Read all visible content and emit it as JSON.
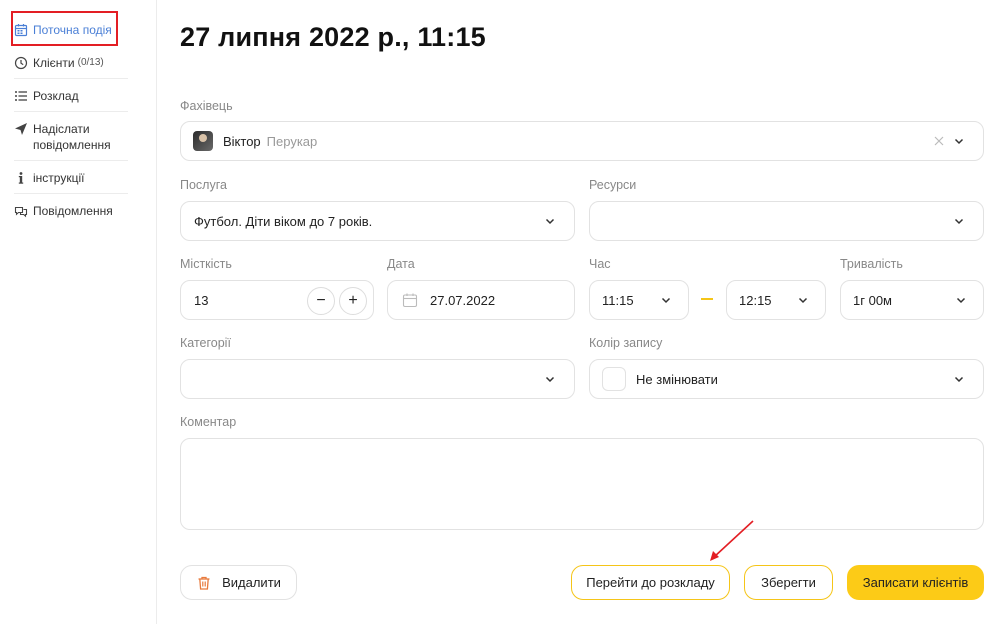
{
  "sidebar": {
    "items": [
      {
        "label": "Поточна подія",
        "icon": "calendar-icon"
      },
      {
        "label": "Клієнти",
        "count": "(0/13)",
        "icon": "clock-icon"
      },
      {
        "label": "Розклад",
        "icon": "list-icon"
      },
      {
        "label": "Надіслати повідомлення",
        "icon": "send-icon"
      },
      {
        "label": "інструкції",
        "icon": "info-icon"
      },
      {
        "label": "Повідомлення",
        "icon": "chat-icon"
      }
    ]
  },
  "page": {
    "title": "27 липня 2022 р., 11:15"
  },
  "form": {
    "specialist": {
      "label": "Фахівець",
      "name": "Віктор",
      "role": "Перукар"
    },
    "service": {
      "label": "Послуга",
      "value": "Футбол. Діти віком до 7 років."
    },
    "resources": {
      "label": "Ресурси",
      "value": ""
    },
    "capacity": {
      "label": "Місткість",
      "value": "13",
      "minus": "−",
      "plus": "+"
    },
    "date": {
      "label": "Дата",
      "value": "27.07.2022"
    },
    "time": {
      "label": "Час",
      "start": "11:15",
      "end": "12:15"
    },
    "duration": {
      "label": "Тривалість",
      "value": "1г 00м"
    },
    "categories": {
      "label": "Категорії",
      "value": ""
    },
    "record_color": {
      "label": "Колір запису",
      "value": "Не змінювати"
    },
    "comment": {
      "label": "Коментар",
      "value": ""
    }
  },
  "actions": {
    "delete_label": "Видалити",
    "goto_schedule_label": "Перейти до розкладу",
    "save_label": "Зберегти",
    "book_clients_label": "Записати клієнтів"
  },
  "colors": {
    "accent_yellow": "#fccb17",
    "active_nav": "#4a7fd6",
    "highlight_red": "#e31e24",
    "trash_orange": "#e87a3c"
  }
}
